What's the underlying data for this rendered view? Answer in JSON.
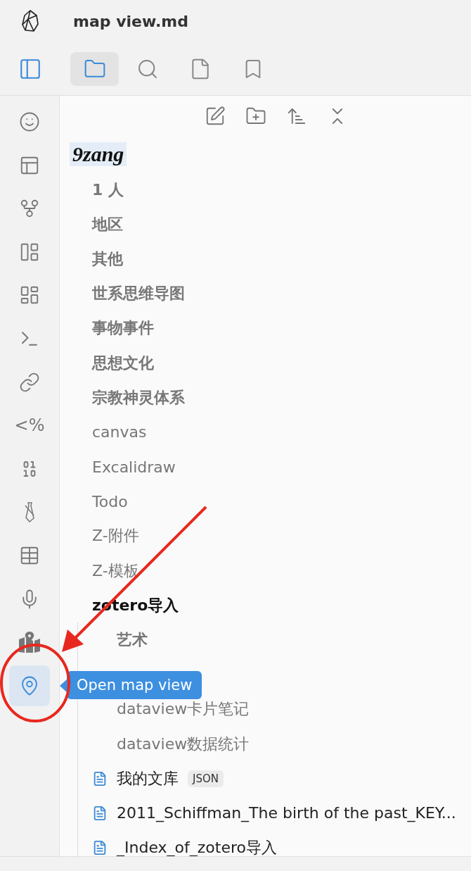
{
  "window": {
    "title": "map view.md"
  },
  "panel_tabs": [
    {
      "selected": true
    },
    {
      "selected": false
    },
    {
      "selected": false
    },
    {
      "selected": false
    }
  ],
  "ribbon": [
    {
      "kind": "icon",
      "selected": false
    },
    {
      "kind": "icon",
      "selected": false
    },
    {
      "kind": "icon",
      "selected": false
    },
    {
      "kind": "icon",
      "selected": false
    },
    {
      "kind": "icon",
      "selected": false
    },
    {
      "kind": "icon",
      "selected": false
    },
    {
      "kind": "icon",
      "selected": false
    },
    {
      "kind": "text",
      "label": "<%",
      "selected": false
    },
    {
      "kind": "icon",
      "selected": false
    },
    {
      "kind": "icon",
      "selected": false
    },
    {
      "kind": "icon",
      "selected": false
    },
    {
      "kind": "icon",
      "selected": false
    },
    {
      "kind": "icon",
      "selected": false
    },
    {
      "kind": "icon",
      "selected": true,
      "tooltip": "Open map view"
    }
  ],
  "vault": {
    "name": "9zang"
  },
  "tree": [
    {
      "kind": "folder",
      "label": "1 人",
      "bold": true,
      "expanded": false
    },
    {
      "kind": "folder",
      "label": "地区",
      "bold": true,
      "expanded": false
    },
    {
      "kind": "folder",
      "label": "其他",
      "bold": true,
      "expanded": false
    },
    {
      "kind": "folder",
      "label": "世系思维导图",
      "bold": true,
      "expanded": false
    },
    {
      "kind": "folder",
      "label": "事物事件",
      "bold": true,
      "expanded": false
    },
    {
      "kind": "folder",
      "label": "思想文化",
      "bold": true,
      "expanded": false
    },
    {
      "kind": "folder",
      "label": "宗教神灵体系",
      "bold": true,
      "expanded": false
    },
    {
      "kind": "folder",
      "label": "canvas",
      "bold": false,
      "expanded": false
    },
    {
      "kind": "folder",
      "label": "Excalidraw",
      "bold": false,
      "expanded": false
    },
    {
      "kind": "folder",
      "label": "Todo",
      "bold": false,
      "expanded": false
    },
    {
      "kind": "folder",
      "label": "Z-附件",
      "bold": false,
      "expanded": false
    },
    {
      "kind": "folder",
      "label": "Z-模板",
      "bold": false,
      "expanded": false
    },
    {
      "kind": "folder",
      "label": "zotero导入",
      "bold": true,
      "expanded": true,
      "children": [
        {
          "kind": "folder",
          "label": "艺术",
          "bold": true,
          "expanded": false
        },
        {
          "kind": "covered"
        },
        {
          "kind": "folder",
          "label": "dataview卡片笔记",
          "bold": false,
          "expanded": false
        },
        {
          "kind": "folder",
          "label": "dataview数据统计",
          "bold": false,
          "expanded": false
        },
        {
          "kind": "file",
          "label": "我的文库",
          "badge": "JSON"
        },
        {
          "kind": "file",
          "label": "2011_Schiffman_The birth of the past_KEY..."
        },
        {
          "kind": "file",
          "label": "_Index_of_zotero导入"
        }
      ]
    }
  ],
  "annotation": {
    "kind": "arrow-and-circle"
  }
}
